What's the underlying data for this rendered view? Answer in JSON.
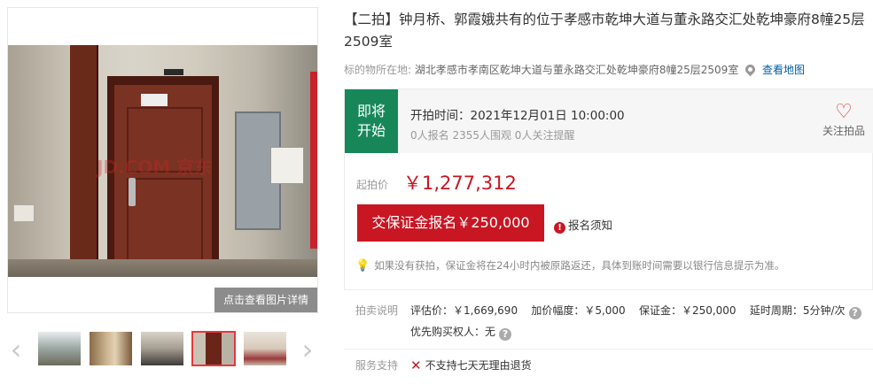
{
  "gallery": {
    "watermark": "JD.COM 京东",
    "detail_button": "点击查看图片详情",
    "prev_arrow": "‹",
    "next_arrow": "›"
  },
  "title": "【二拍】钟月桥、郭霞娥共有的位于孝感市乾坤大道与董永路交汇处乾坤豪府8幢25层2509室",
  "location": {
    "label": "标的物所在地:",
    "address": "湖北孝感市孝南区乾坤大道与董永路交汇处乾坤豪府8幢25层2509室",
    "map_link": "查看地图"
  },
  "status": {
    "tag_line1": "即将",
    "tag_line2": "开始",
    "start_time": "开拍时间：2021年12月01日 10:00:00",
    "counts": "0人报名   2355人围观   0人关注提醒",
    "follow_label": "关注拍品",
    "tag_color": "#17875a"
  },
  "price": {
    "label": "起拍价",
    "value": "￥1,277,312"
  },
  "deposit_button": "交保证金报名￥250,000",
  "notice": "报名须知",
  "tip": "如果没有获拍，保证金将在24小时内被原路返还，具体到账时间需要以银行信息提示为准。",
  "description": {
    "label": "拍卖说明",
    "line1": "评估价：￥1,669,690    加价幅度：￥5,000    保证金：￥250,000    延时周期：5分钟/次",
    "line2": "优先购买权人：无"
  },
  "service": {
    "label": "服务支持",
    "text": "不支持七天无理由退货"
  },
  "accent_color": "#c81623"
}
